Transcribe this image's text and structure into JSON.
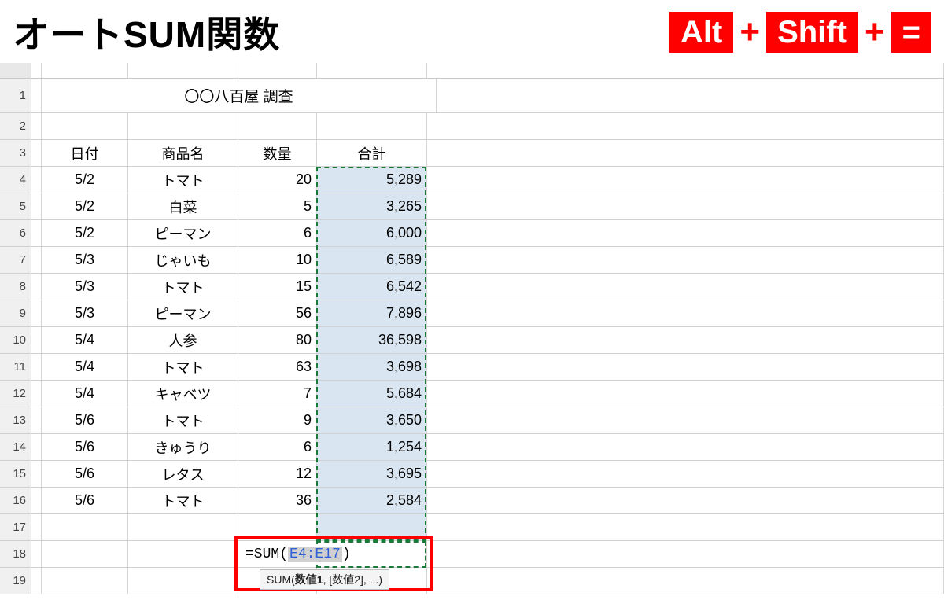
{
  "title": "オートSUM関数",
  "shortcut": {
    "k1": "Alt",
    "plus": "+",
    "k2": "Shift",
    "k3": "="
  },
  "sheet_title": "〇〇八百屋 調査",
  "headers": {
    "date": "日付",
    "product": "商品名",
    "qty": "数量",
    "sum": "合計"
  },
  "rows": [
    {
      "n": "4",
      "date": "5/2",
      "product": "トマト",
      "qty": "20",
      "sum": "5,289"
    },
    {
      "n": "5",
      "date": "5/2",
      "product": "白菜",
      "qty": "5",
      "sum": "3,265"
    },
    {
      "n": "6",
      "date": "5/2",
      "product": "ピーマン",
      "qty": "6",
      "sum": "6,000"
    },
    {
      "n": "7",
      "date": "5/3",
      "product": "じゃいも",
      "qty": "10",
      "sum": "6,589"
    },
    {
      "n": "8",
      "date": "5/3",
      "product": "トマト",
      "qty": "15",
      "sum": "6,542"
    },
    {
      "n": "9",
      "date": "5/3",
      "product": "ピーマン",
      "qty": "56",
      "sum": "7,896"
    },
    {
      "n": "10",
      "date": "5/4",
      "product": "人参",
      "qty": "80",
      "sum": "36,598"
    },
    {
      "n": "11",
      "date": "5/4",
      "product": "トマト",
      "qty": "63",
      "sum": "3,698"
    },
    {
      "n": "12",
      "date": "5/4",
      "product": "キャベツ",
      "qty": "7",
      "sum": "5,684"
    },
    {
      "n": "13",
      "date": "5/6",
      "product": "トマト",
      "qty": "9",
      "sum": "3,650"
    },
    {
      "n": "14",
      "date": "5/6",
      "product": "きゅうり",
      "qty": "6",
      "sum": "1,254"
    },
    {
      "n": "15",
      "date": "5/6",
      "product": "レタス",
      "qty": "12",
      "sum": "3,695"
    },
    {
      "n": "16",
      "date": "5/6",
      "product": "トマト",
      "qty": "36",
      "sum": "2,584"
    }
  ],
  "rownums_extra": {
    "r1": "1",
    "r2": "2",
    "r3": "3",
    "r17": "17",
    "r18": "18",
    "r19": "19"
  },
  "formula": {
    "prefix": "=SUM(",
    "ref": "E4:E17",
    "suffix": ")"
  },
  "tooltip": {
    "fn": "SUM(",
    "arg1": "数値1",
    "rest": ", [数値2], ...)"
  }
}
